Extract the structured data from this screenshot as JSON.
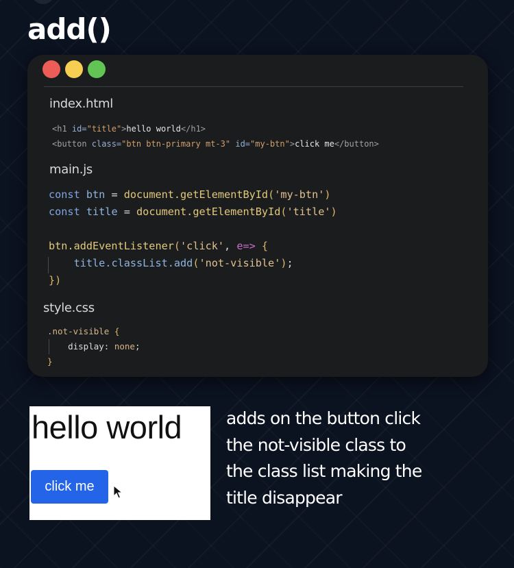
{
  "title": "add()",
  "code_card": {
    "files": {
      "html": {
        "name": "index.html",
        "lines": [
          [
            {
              "t": "<h1 ",
              "k": "tag"
            },
            {
              "t": "id=",
              "k": "attr"
            },
            {
              "t": "\"title\"",
              "k": "str"
            },
            {
              "t": ">",
              "k": "tag"
            },
            {
              "t": "hello world",
              "k": "text"
            },
            {
              "t": "</h1>",
              "k": "tag"
            }
          ],
          [
            {
              "t": "<button ",
              "k": "tag"
            },
            {
              "t": "class=",
              "k": "attr"
            },
            {
              "t": "\"btn btn-primary mt-3\"",
              "k": "str"
            },
            {
              "t": " ",
              "k": "text"
            },
            {
              "t": "id=",
              "k": "attr"
            },
            {
              "t": "\"my-btn\"",
              "k": "str"
            },
            {
              "t": ">",
              "k": "tag"
            },
            {
              "t": "click me",
              "k": "text"
            },
            {
              "t": "</button>",
              "k": "tag"
            }
          ]
        ]
      },
      "js": {
        "name": "main.js",
        "lines": [
          [
            {
              "t": "const ",
              "k": "kw"
            },
            {
              "t": "btn",
              "k": "var"
            },
            {
              "t": " = ",
              "k": "op"
            },
            {
              "t": "document.getElementById",
              "k": "fn"
            },
            {
              "t": "(",
              "k": "paren"
            },
            {
              "t": "'my-btn'",
              "k": "strg"
            },
            {
              "t": ")",
              "k": "paren"
            }
          ],
          [
            {
              "t": "const ",
              "k": "kw"
            },
            {
              "t": "title",
              "k": "var"
            },
            {
              "t": " = ",
              "k": "op"
            },
            {
              "t": "document.getElementById",
              "k": "fn"
            },
            {
              "t": "(",
              "k": "paren"
            },
            {
              "t": "'title'",
              "k": "strg"
            },
            {
              "t": ")",
              "k": "paren"
            }
          ],
          [],
          [
            {
              "t": "btn.addEventListener",
              "k": "fn"
            },
            {
              "t": "(",
              "k": "paren"
            },
            {
              "t": "'click'",
              "k": "strg"
            },
            {
              "t": ", ",
              "k": "op"
            },
            {
              "t": "e=>",
              "k": "arrow"
            },
            {
              "t": " {",
              "k": "paren"
            }
          ],
          [
            {
              "t": "    ",
              "k": "op"
            },
            {
              "t": "title.classList.add",
              "k": "var"
            },
            {
              "t": "(",
              "k": "paren"
            },
            {
              "t": "'not-visible'",
              "k": "strg"
            },
            {
              "t": ")",
              "k": "paren"
            },
            {
              "t": ";",
              "k": "op"
            }
          ],
          [
            {
              "t": "})",
              "k": "paren"
            }
          ]
        ]
      },
      "css": {
        "name": "style.css",
        "lines": [
          [
            {
              "t": ".not-visible ",
              "k": "sel"
            },
            {
              "t": "{",
              "k": "paren"
            }
          ],
          [
            {
              "t": "    ",
              "k": "op"
            },
            {
              "t": "display",
              "k": "prop"
            },
            {
              "t": ": ",
              "k": "op"
            },
            {
              "t": "none",
              "k": "sel"
            },
            {
              "t": ";",
              "k": "op"
            }
          ],
          [
            {
              "t": "}",
              "k": "paren"
            }
          ]
        ]
      }
    }
  },
  "preview": {
    "heading": "hello world",
    "button_label": "click me"
  },
  "description": {
    "lines": [
      "adds on the button click",
      "the not-visible class to",
      "the class list making the",
      "title disappear"
    ]
  },
  "colors": {
    "background": "#0b1220",
    "card": "#1b1c1e",
    "button": "#2364e8"
  }
}
